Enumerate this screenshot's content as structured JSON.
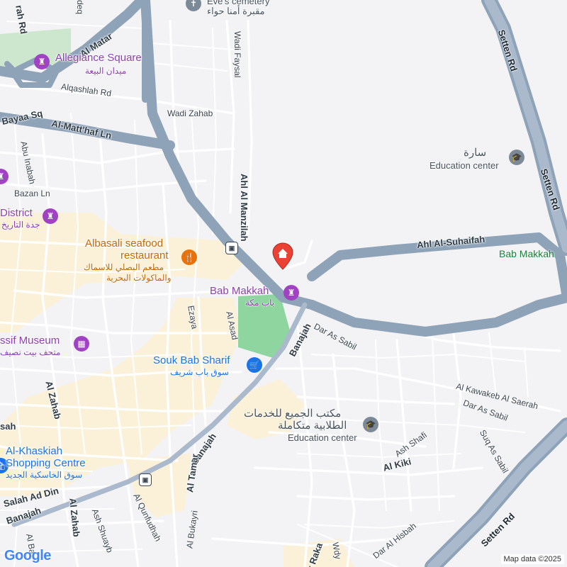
{
  "map": {
    "colors": {
      "background": "#f3f3f5",
      "minor_road": "#ffffff",
      "arterial": "#8ea2b8",
      "commercial_area": "#fbf1d9",
      "park": "#8fd5a0",
      "marker": "#ea4335"
    },
    "roads": {
      "al_matar": "Al Matar",
      "rah_rd": "rah Rd",
      "bayaa_sq": "Bayaa Sq",
      "al_matthaf": "Al-Matt'haf Ln",
      "alqashlah": "Alqashlah Rd",
      "wadi_zahab": "Wadi Zahab",
      "wadi_faysal": "Wadi Faysal",
      "abu_inabah": "Abu Inabah",
      "bazan": "Bazan Ln",
      "ahl_al_manzilah": "Ahl Al Manzilah",
      "setten_top": "Setten Rd",
      "setten_right": "Setten Rd",
      "setten_bottom": "Setten Rd",
      "ahl_al_suhaifah": "Ahl Al-Suhaifah",
      "al_asad": "Al Asad",
      "ezaya": "Ezaya",
      "banajah_1": "Banajah",
      "banajah_2": "Banajah",
      "banajah_3": "Banajah",
      "dar_as_sabil_1": "Dar As Sabil",
      "dar_as_sabil_2": "Dar As Sabil",
      "al_kawakeb": "Al Kawakeb Al Saerah",
      "ash_shafi": "Ash Shafi",
      "suq_as_sabil": "Suq As Sabil",
      "al_kiki": "Al Kiki",
      "al_zahab_1": "Al Zahab",
      "al_zahab_2": "Al Zahab",
      "al_tamar": "Al Tamar",
      "al_bukayri": "Al Bukayri",
      "al_qunfudhah": "Al Qunfudhah",
      "ash_shuayb": "Ash Shuayb",
      "salah_ad_din": "Salah Ad Din",
      "sah": "sah",
      "al_dar_al_hisbah": "Dar Al Hisbah",
      "ar_raka": "Ar Raka",
      "al_ba": "Al Ba",
      "wdy": "Wdy",
      "deq": "deq"
    },
    "pois": {
      "eves_cemetery": {
        "name": "Eve's cemetery",
        "name_ar": "مقبرة أمنا حواء"
      },
      "allegiance_square": {
        "name": "Allegiance Square",
        "name_ar": "ميدان البيعة",
        "icon": "landmark-icon"
      },
      "district": {
        "name": "District",
        "name_ar": "جدة التاريخ",
        "icon": "landmark-icon"
      },
      "albasali": {
        "name_line1": "Albasali seafood",
        "name_line2": "restaurant",
        "name_ar_line1": "مطعم البصلي للاسماك",
        "name_ar_line2": "والماكولات البحرية",
        "icon": "restaurant-icon"
      },
      "bab_makkah": {
        "name": "Bab Makkah",
        "name_ar": "باب مكة",
        "icon": "landmark-icon"
      },
      "bab_makkah_right": {
        "name": "Bab Makkah"
      },
      "sara": {
        "name_ar": "سارة",
        "category": "Education center",
        "icon": "graduation-cap-icon"
      },
      "museum": {
        "name": "ssif Museum",
        "name_ar": "متحف بيت نصيف",
        "icon": "museum-icon"
      },
      "souk": {
        "name": "Souk Bab Sharif",
        "name_ar": "سوق باب شريف",
        "icon": "shopping-cart-icon"
      },
      "maktab": {
        "name_ar_line1": "مكتب الجميع للخدمات",
        "name_ar_line2": "الطلابية متكاملة",
        "category": "Education center",
        "icon": "graduation-cap-icon"
      },
      "khaskiah": {
        "name_line1": "Al-Khaskiah",
        "name_line2": "Shopping Centre",
        "name_ar": "سوق الخاسكية الجديد",
        "icon": "shopping-bag-icon"
      }
    },
    "attribution": {
      "logo": "Google",
      "data": "Map data ©2025"
    }
  }
}
